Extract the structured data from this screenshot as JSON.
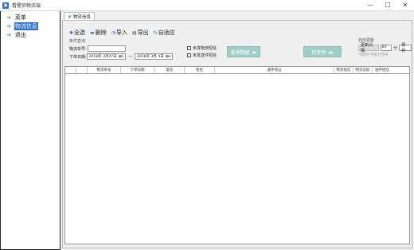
{
  "window": {
    "title": "看警员物流端"
  },
  "sidebar": {
    "items": [
      {
        "label": "菜单"
      },
      {
        "label": "物流信息"
      },
      {
        "label": "退出"
      }
    ]
  },
  "tab": {
    "label": "物流信息"
  },
  "toolbar": {
    "select_all": "全选",
    "delete": "删除",
    "import": "导入",
    "export": "导出",
    "adapt": "自适应"
  },
  "query": {
    "group_title": "条件查询",
    "waybill_label": "物流单号:",
    "waybill_value": "",
    "date_label": "下单日期:",
    "date_from": "2018年 3月27日",
    "date_to": "2018年 3月 4日",
    "date_sep": "—",
    "check_unsent": "未发物流短信",
    "check_unreached": "未发送件短信",
    "query_button": "查询数据",
    "sync_button": "同步件"
  },
  "update": {
    "group_title": "自动更新",
    "interval_label": "更新间隔",
    "interval_value": "60",
    "unit": "分",
    "save_button": "保存",
    "note": "不超时,不能为空值"
  },
  "grid": {
    "columns": [
      "",
      "",
      "物流单号",
      "下单日期",
      "电话",
      "姓名",
      "收件地址",
      "物流短信",
      "物流追踪",
      "送件短信"
    ]
  }
}
